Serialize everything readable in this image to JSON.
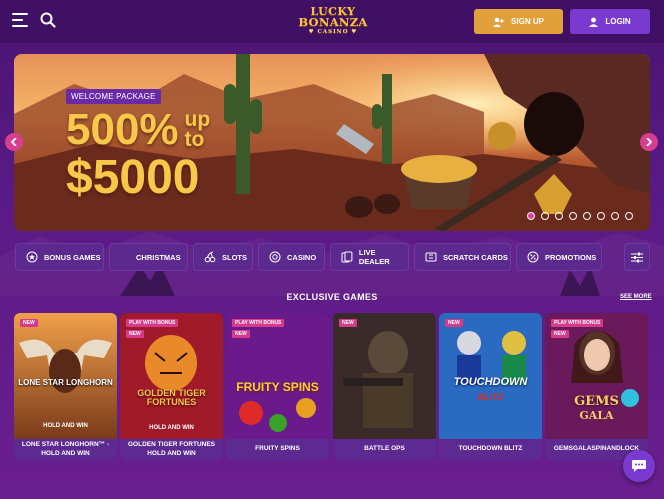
{
  "header": {
    "logo_line1": "LUCKY",
    "logo_line2": "BONANZA",
    "logo_line3": "♥ CASINO ♥",
    "signup_label": "SIGN UP",
    "login_label": "LOGIN",
    "menu_icon": "hamburger-icon",
    "search_icon": "search-icon"
  },
  "banner": {
    "badge": "WELCOME PACKAGE",
    "amount_line1": "500%",
    "amount_upto": "up to",
    "amount_line2": "$5000",
    "slides_count": 8,
    "active_slide": 1
  },
  "categories": [
    {
      "label": "BONUS GAMES",
      "icon": "star-badge-icon"
    },
    {
      "label": "CHRISTMAS",
      "icon": ""
    },
    {
      "label": "SLOTS",
      "icon": "cherry-icon"
    },
    {
      "label": "CASINO",
      "icon": "chip-icon"
    },
    {
      "label": "LIVE DEALER",
      "icon": "cards-icon"
    },
    {
      "label": "SCRATCH CARDS",
      "icon": "ticket-icon"
    },
    {
      "label": "PROMOTIONS",
      "icon": "percent-icon"
    }
  ],
  "section": {
    "title": "EXCLUSIVE GAMES",
    "see_more": "SEE MORE"
  },
  "games": [
    {
      "title": "LONE STAR LONGHORN™ - HOLD AND WIN",
      "badge": "NEW",
      "logo": "LONE STAR LONGHORN",
      "sub": "HOLD AND WIN"
    },
    {
      "title": "GOLDEN TIGER FORTUNES HOLD AND WIN",
      "badge": "PLAY WITH BONUS",
      "badge2": "NEW",
      "logo": "GOLDEN TIGER FORTUNES",
      "sub": "HOLD AND WIN"
    },
    {
      "title": "FRUITY SPINS",
      "badge": "PLAY WITH BONUS",
      "badge2": "NEW",
      "logo": "FRUITY SPINS"
    },
    {
      "title": "BATTLE OPS",
      "badge": "NEW"
    },
    {
      "title": "TOUCHDOWN BLITZ",
      "badge": "NEW",
      "logo": "TOUCHDOWN",
      "logo2": "BLITZ"
    },
    {
      "title": "GEMSGALASPINANDLOCK",
      "badge": "PLAY WITH BONUS",
      "badge2": "NEW",
      "logo": "GEMS",
      "logo2": "GALA"
    }
  ],
  "colors": {
    "signup": "#e2a03a",
    "login": "#7a3ad0",
    "accent_pink": "#d63f8f",
    "background": "#4a1470"
  }
}
